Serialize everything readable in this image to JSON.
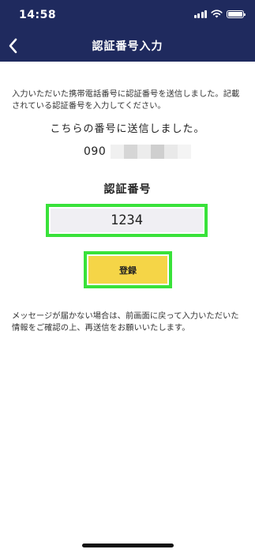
{
  "status_bar": {
    "time": "14:58",
    "icons": [
      "signal-icon",
      "wifi-icon",
      "battery-icon"
    ]
  },
  "nav": {
    "back_icon": "chevron-left-icon",
    "title": "認証番号入力"
  },
  "main": {
    "description": "入力いただいた携帯電話番号に認証番号を送信しました。記載されている認証番号を入力してください。",
    "sent_label": "こちらの番号に送信しました。",
    "phone_prefix": "090",
    "code_label": "認証番号",
    "code_value": "1234",
    "submit_label": "登録",
    "note": "メッセージが届かない場合は、前画面に戻って入力いただいた情報をご確認の上、再送信をお願いいたします。"
  },
  "colors": {
    "header_bg": "#1f2a5e",
    "button_bg": "#f5d547",
    "highlight_border": "#39e23a",
    "input_bg": "#f0eff3"
  }
}
